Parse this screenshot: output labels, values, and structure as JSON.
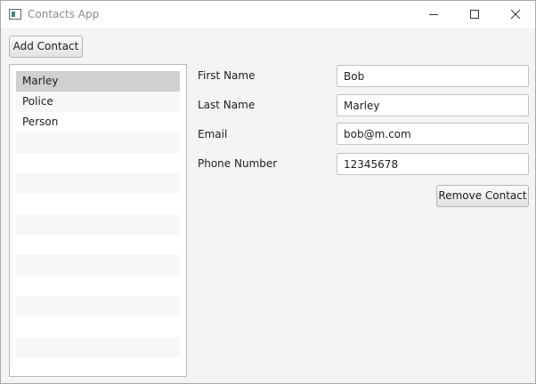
{
  "window": {
    "title": "Contacts App"
  },
  "toolbar": {
    "add_label": "Add Contact"
  },
  "contacts": [
    "Marley",
    "Police",
    "Person"
  ],
  "selected_contact": "Marley",
  "form": {
    "first_name": {
      "label": "First Name",
      "value": "Bob"
    },
    "last_name": {
      "label": "Last Name",
      "value": "Marley"
    },
    "email": {
      "label": "Email",
      "value": "bob@m.com"
    },
    "phone": {
      "label": "Phone Number",
      "value": "12345678"
    }
  },
  "actions": {
    "remove_label": "Remove Contact"
  },
  "icons": [
    "app-icon",
    "minimize-icon",
    "maximize-icon",
    "close-icon"
  ]
}
